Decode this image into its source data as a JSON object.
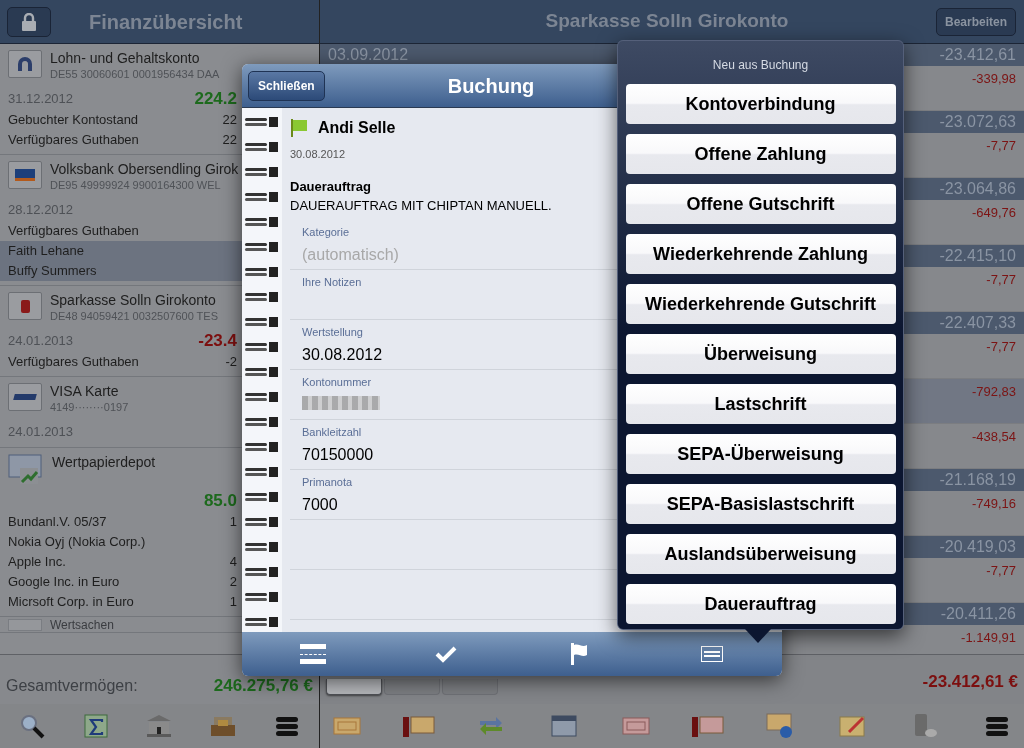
{
  "left": {
    "title": "Finanzübersicht",
    "accounts": [
      {
        "name": "Lohn- und Gehaltskonto",
        "number": "DE55 30060601 0001956434 DAA",
        "date": "31.12.2012",
        "amount": "224.2",
        "lines": [
          {
            "label": "Gebuchter Kontostand",
            "value": "22",
            "selected": false
          },
          {
            "label": "Verfügbares Guthaben",
            "value": "22",
            "selected": false
          }
        ]
      },
      {
        "name": "Volksbank Obersendling Girok",
        "number": "DE95 49999924 9900164300 WEL",
        "date": "28.12.2012",
        "lines": [
          {
            "label": "Verfügbares Guthaben",
            "selected": false
          },
          {
            "label": "Faith Lehane",
            "selected": true
          },
          {
            "label": "Buffy Summers",
            "selected": true
          }
        ]
      },
      {
        "name": "Sparkasse Solln Girokonto",
        "number": "DE48 94059421 0032507600 TES",
        "date": "24.01.2013",
        "amount": "-23.4",
        "lines": [
          {
            "label": "Verfügbares Guthaben",
            "value": "-2",
            "selected": false
          }
        ]
      },
      {
        "name": "VISA Karte",
        "number": "4149········0197",
        "date": "24.01.2013"
      },
      {
        "name": "Wertpapierdepot",
        "amount": "85.0",
        "lines": [
          {
            "label": "Bundanl.V. 05/37",
            "value": "1",
            "selected": false
          },
          {
            "label": "Nokia Oyj (Nokia Corp.)",
            "selected": false
          },
          {
            "label": "Apple Inc.",
            "value": "4",
            "selected": false
          },
          {
            "label": "Google Inc. in Euro",
            "value": "2",
            "selected": false
          },
          {
            "label": "Micrsoft Corp. in Euro",
            "value": "1",
            "selected": false
          }
        ]
      },
      {
        "name": "Wertsachen"
      }
    ],
    "total_label": "Gesamtvermögen:",
    "total": "246.275,76 €"
  },
  "right": {
    "title": "Sparkasse Solln Girokonto",
    "edit_button": "Bearbeiten",
    "rows": [
      {
        "kind": "header",
        "date": "03.09.2012",
        "balance": "-23.412,61"
      },
      {
        "kind": "item",
        "amount": "-339,98",
        "selected": false
      },
      {
        "kind": "header",
        "balance": "-23.072,63"
      },
      {
        "kind": "item",
        "amount": "-7,77",
        "selected": false
      },
      {
        "kind": "header",
        "balance": "-23.064,86"
      },
      {
        "kind": "item",
        "amount": "-649,76",
        "selected": false
      },
      {
        "kind": "header",
        "balance": "-22.415,10"
      },
      {
        "kind": "item",
        "amount": "-7,77",
        "selected": false
      },
      {
        "kind": "header",
        "balance": "-22.407,33"
      },
      {
        "kind": "item",
        "amount": "-7,77",
        "selected": false
      },
      {
        "kind": "item",
        "amount": "-792,83",
        "selected": true
      },
      {
        "kind": "item",
        "amount": "-438,54",
        "selected": false
      },
      {
        "kind": "header",
        "balance": "-21.168,19"
      },
      {
        "kind": "item",
        "amount": "-749,16",
        "selected": false
      },
      {
        "kind": "header",
        "balance": "-20.419,03"
      },
      {
        "kind": "item",
        "amount": "-7,77",
        "selected": false
      },
      {
        "kind": "header",
        "balance": "-20.411,26"
      },
      {
        "kind": "item",
        "amount": "-1.149,91",
        "selected": false
      }
    ],
    "view_tabs": [
      {
        "selected": true
      },
      {
        "selected": false
      },
      {
        "selected": false
      }
    ],
    "total": "-23.412,61 €"
  },
  "modal": {
    "close_button": "Schließen",
    "title": "Buchung",
    "payee": "Andi Selle",
    "flagged": true,
    "date": "30.08.2012",
    "type": "Dauerauftrag",
    "purpose": "DAUERAUFTRAG MIT CHIPTAN MANUELL.",
    "fields": [
      {
        "label": "Kategorie",
        "placeholder": "(automatisch)"
      },
      {
        "label": "Ihre Notizen"
      },
      {
        "label": "Wertstellung",
        "value": "30.08.2012"
      },
      {
        "label": "Kontonummer",
        "blurred": true
      },
      {
        "label": "Bankleitzahl",
        "value": "70150000"
      },
      {
        "label": "Primanota",
        "value": "7000"
      }
    ]
  },
  "popover": {
    "title": "Neu aus Buchung",
    "options": [
      "Kontoverbindung",
      "Offene Zahlung",
      "Offene Gutschrift",
      "Wiederkehrende Zahlung",
      "Wiederkehrende Gutschrift",
      "Überweisung",
      "Lastschrift",
      "SEPA-Überweisung",
      "SEPA-Basislastschrift",
      "Auslandsüberweisung",
      "Dauerauftrag"
    ]
  }
}
